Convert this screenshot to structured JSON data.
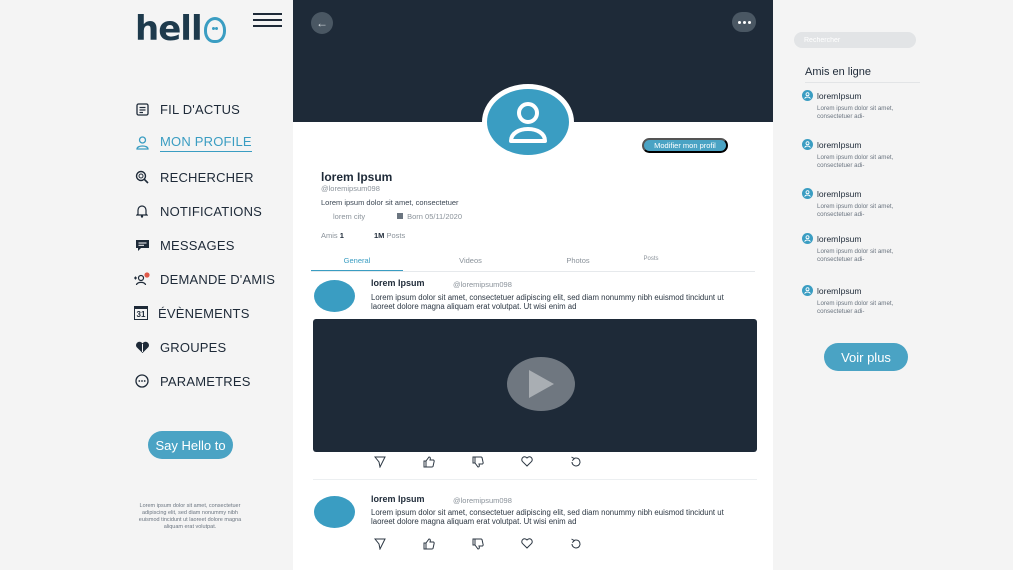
{
  "brand": {
    "logo_text": "hello"
  },
  "sidebar": {
    "items": [
      {
        "label": "FIL D'ACTUS",
        "icon": "news-icon"
      },
      {
        "label": "MON PROFILE",
        "icon": "user-icon",
        "active": true
      },
      {
        "label": "RECHERCHER",
        "icon": "search-icon"
      },
      {
        "label": "NOTIFICATIONS",
        "icon": "bell-icon"
      },
      {
        "label": "MESSAGES",
        "icon": "chat-icon"
      },
      {
        "label": "DEMANDE D'AMIS",
        "icon": "friend-request-icon"
      },
      {
        "label": "ÉVÈNEMENTS",
        "icon": "calendar-icon"
      },
      {
        "label": "GROUPES",
        "icon": "group-icon"
      },
      {
        "label": "PARAMETRES",
        "icon": "settings-icon"
      }
    ],
    "calendar_day": "31",
    "say_hello_label": "Say Hello to",
    "footer_text": "Lorem ipsum dolor sit amet, consectetuer adipiscing elit, sed diam nonummy nibh euismod tincidunt ut laoreet dolore magna aliquam erat volutpat."
  },
  "profile": {
    "edit_label": "Modifier mon profil",
    "name": "lorem Ipsum",
    "handle": "@loremipsum098",
    "bio": "Lorem ipsum dolor sit amet, consectetuer",
    "city": "lorem city",
    "born": "Born 05/11/2020",
    "friends_label": "Amis",
    "friends_count": "1",
    "posts_count": "1M",
    "posts_label": "Posts"
  },
  "tabs": [
    "General",
    "Videos",
    "Photos",
    "Posts"
  ],
  "posts": [
    {
      "author": "lorem Ipsum",
      "handle": "@loremipsum098",
      "text": "Lorem ipsum dolor sit amet, consectetuer adipiscing elit, sed diam nonummy nibh euismod tincidunt ut laoreet dolore magna aliquam erat volutpat. Ut wisi enim ad"
    },
    {
      "author": "lorem Ipsum",
      "handle": "@loremipsum098",
      "text": "Lorem ipsum dolor sit amet, consectetuer adipiscing elit, sed diam nonummy nibh euismod tincidunt ut laoreet dolore magna aliquam erat volutpat. Ut wisi enim ad"
    }
  ],
  "right": {
    "search_placeholder": "Rechercher",
    "friends_title": "Amis en ligne",
    "friends": [
      {
        "name": "loremIpsum",
        "text": "Lorem ipsum dolor sit amet, consectetuer adi-"
      },
      {
        "name": "loremIpsum",
        "text": "Lorem ipsum dolor sit amet, consectetuer adi-"
      },
      {
        "name": "loremIpsum",
        "text": "Lorem ipsum dolor sit amet, consectetuer adi-"
      },
      {
        "name": "loremIpsum",
        "text": "Lorem ipsum dolor sit amet, consectetuer adi-"
      },
      {
        "name": "loremIpsum",
        "text": "Lorem ipsum dolor sit amet, consectetuer adi-"
      }
    ],
    "voir_plus_label": "Voir plus"
  },
  "colors": {
    "accent": "#3a9dc2",
    "dark": "#1e2a38",
    "background": "#f4f4f4"
  }
}
